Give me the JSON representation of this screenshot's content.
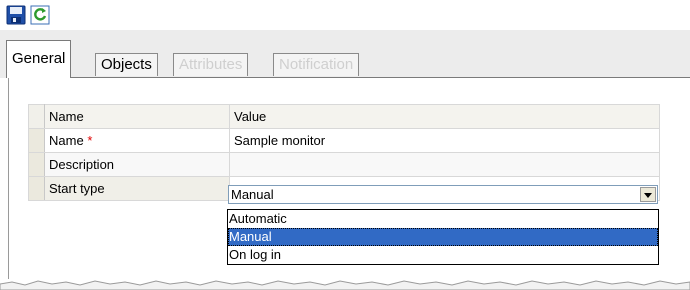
{
  "toolbar": {
    "save_icon": "save-icon",
    "refresh_icon": "refresh-icon"
  },
  "tabs": [
    {
      "label": "General",
      "state": "active"
    },
    {
      "label": "Objects",
      "state": "enabled"
    },
    {
      "label": "Attributes",
      "state": "disabled"
    },
    {
      "label": "Notification",
      "state": "disabled"
    }
  ],
  "grid": {
    "header": {
      "name": "Name",
      "value": "Value"
    },
    "rows": [
      {
        "name": "Name",
        "required_mark": "*",
        "value": "Sample monitor"
      },
      {
        "name": "Description",
        "value": ""
      },
      {
        "name": "Start type",
        "value": "Manual"
      }
    ]
  },
  "start_type_dropdown": {
    "selected": "Manual",
    "options": [
      "Automatic",
      "Manual",
      "On log in"
    ],
    "highlighted_option": "Manual"
  },
  "colors": {
    "selection": "#316ac5",
    "required": "#e00000",
    "tab_strip": "#ececec",
    "gutter": "#ebe9de"
  }
}
